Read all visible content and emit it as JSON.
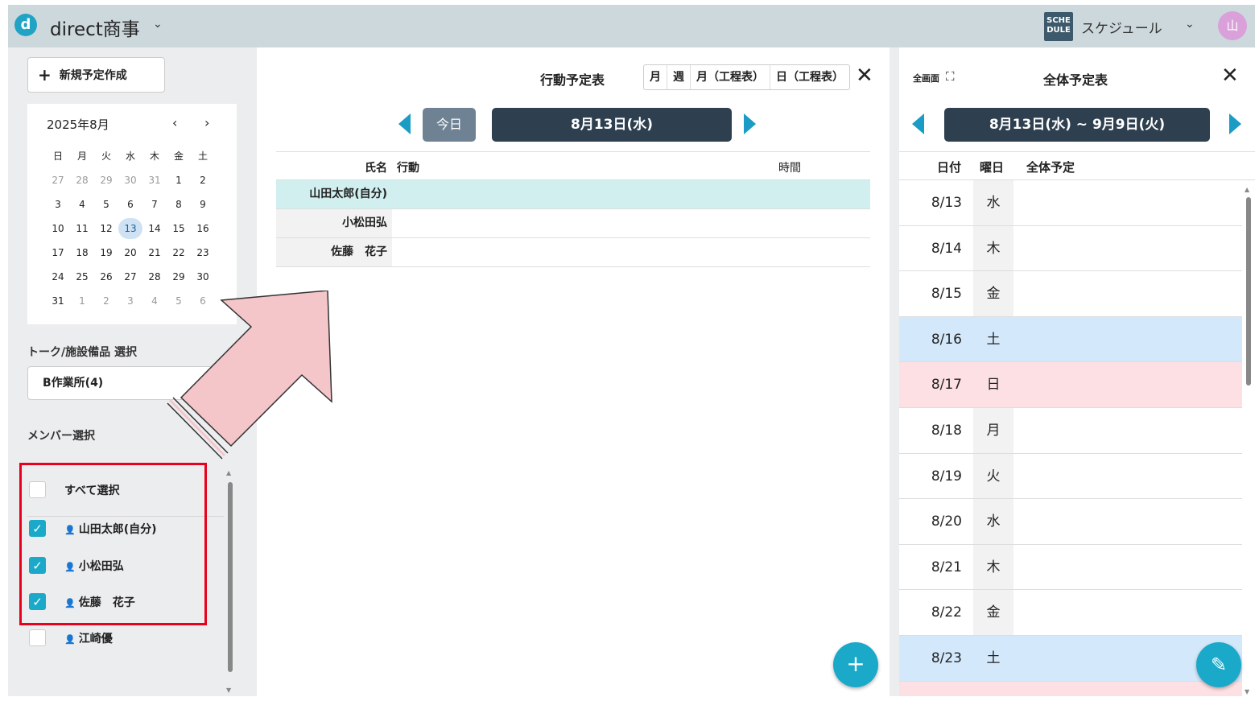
{
  "header": {
    "logo_letter": "d",
    "company": "direct商事",
    "company_chevron": "⌄",
    "app_icon_text": "SCHE DULE",
    "app_name": "スケジュール",
    "app_chevron": "⌄",
    "avatar_text": "山"
  },
  "sidebar": {
    "new_button": "新規予定作成",
    "new_plus": "+",
    "calendar": {
      "title": "2025年8月",
      "prev": "‹",
      "next": "›",
      "weekdays": [
        "日",
        "月",
        "火",
        "水",
        "木",
        "金",
        "土"
      ],
      "weeks": [
        [
          "27",
          "28",
          "29",
          "30",
          "31",
          "1",
          "2"
        ],
        [
          "3",
          "4",
          "5",
          "6",
          "7",
          "8",
          "9"
        ],
        [
          "10",
          "11",
          "12",
          "13",
          "14",
          "15",
          "16"
        ],
        [
          "17",
          "18",
          "19",
          "20",
          "21",
          "22",
          "23"
        ],
        [
          "24",
          "25",
          "26",
          "27",
          "28",
          "29",
          "30"
        ],
        [
          "31",
          "1",
          "2",
          "3",
          "4",
          "5",
          "6"
        ]
      ],
      "selected_day": "13"
    },
    "talk_label": "トーク/施設備品 選択",
    "talk_value": "B作業所(4)",
    "member_label": "メンバー選択",
    "members": [
      {
        "name": "すべて選択",
        "checked": false,
        "icon": false
      },
      {
        "name": "山田太郎(自分)",
        "checked": true,
        "icon": true
      },
      {
        "name": "小松田弘",
        "checked": true,
        "icon": true
      },
      {
        "name": "佐藤　花子",
        "checked": true,
        "icon": true
      },
      {
        "name": "江崎優",
        "checked": false,
        "icon": true
      }
    ]
  },
  "center": {
    "title": "行動予定表",
    "view_tabs": [
      "月",
      "週",
      "月（工程表）",
      "日（工程表）"
    ],
    "close": "✕",
    "today": "今日",
    "date": "8月13日(水)",
    "table_headers": {
      "name": "氏名",
      "action": "行動",
      "time": "時間"
    },
    "rows": [
      "山田太郎(自分)",
      "小松田弘",
      "佐藤　花子"
    ],
    "fab": "+"
  },
  "right": {
    "fullscreen": "全画面",
    "fullscreen_icon": "⛶",
    "title": "全体予定表",
    "close": "✕",
    "range": "8月13日(水) ~ 9月9日(火)",
    "headers": {
      "date": "日付",
      "weekday": "曜日",
      "schedule": "全体予定"
    },
    "rows": [
      {
        "date": "8/13",
        "weekday": "水",
        "type": "normal"
      },
      {
        "date": "8/14",
        "weekday": "木",
        "type": "normal"
      },
      {
        "date": "8/15",
        "weekday": "金",
        "type": "normal"
      },
      {
        "date": "8/16",
        "weekday": "土",
        "type": "sat"
      },
      {
        "date": "8/17",
        "weekday": "日",
        "type": "sun"
      },
      {
        "date": "8/18",
        "weekday": "月",
        "type": "normal"
      },
      {
        "date": "8/19",
        "weekday": "火",
        "type": "normal"
      },
      {
        "date": "8/20",
        "weekday": "水",
        "type": "normal"
      },
      {
        "date": "8/21",
        "weekday": "木",
        "type": "normal"
      },
      {
        "date": "8/22",
        "weekday": "金",
        "type": "normal"
      },
      {
        "date": "8/23",
        "weekday": "土",
        "type": "sat"
      },
      {
        "date": "",
        "weekday": "",
        "type": "sun"
      }
    ],
    "edit_icon": "✎"
  },
  "colors": {
    "accent": "#1aa9c9",
    "highlight_box": "#e8001c",
    "arrow_fill": "#f4c6c9"
  }
}
